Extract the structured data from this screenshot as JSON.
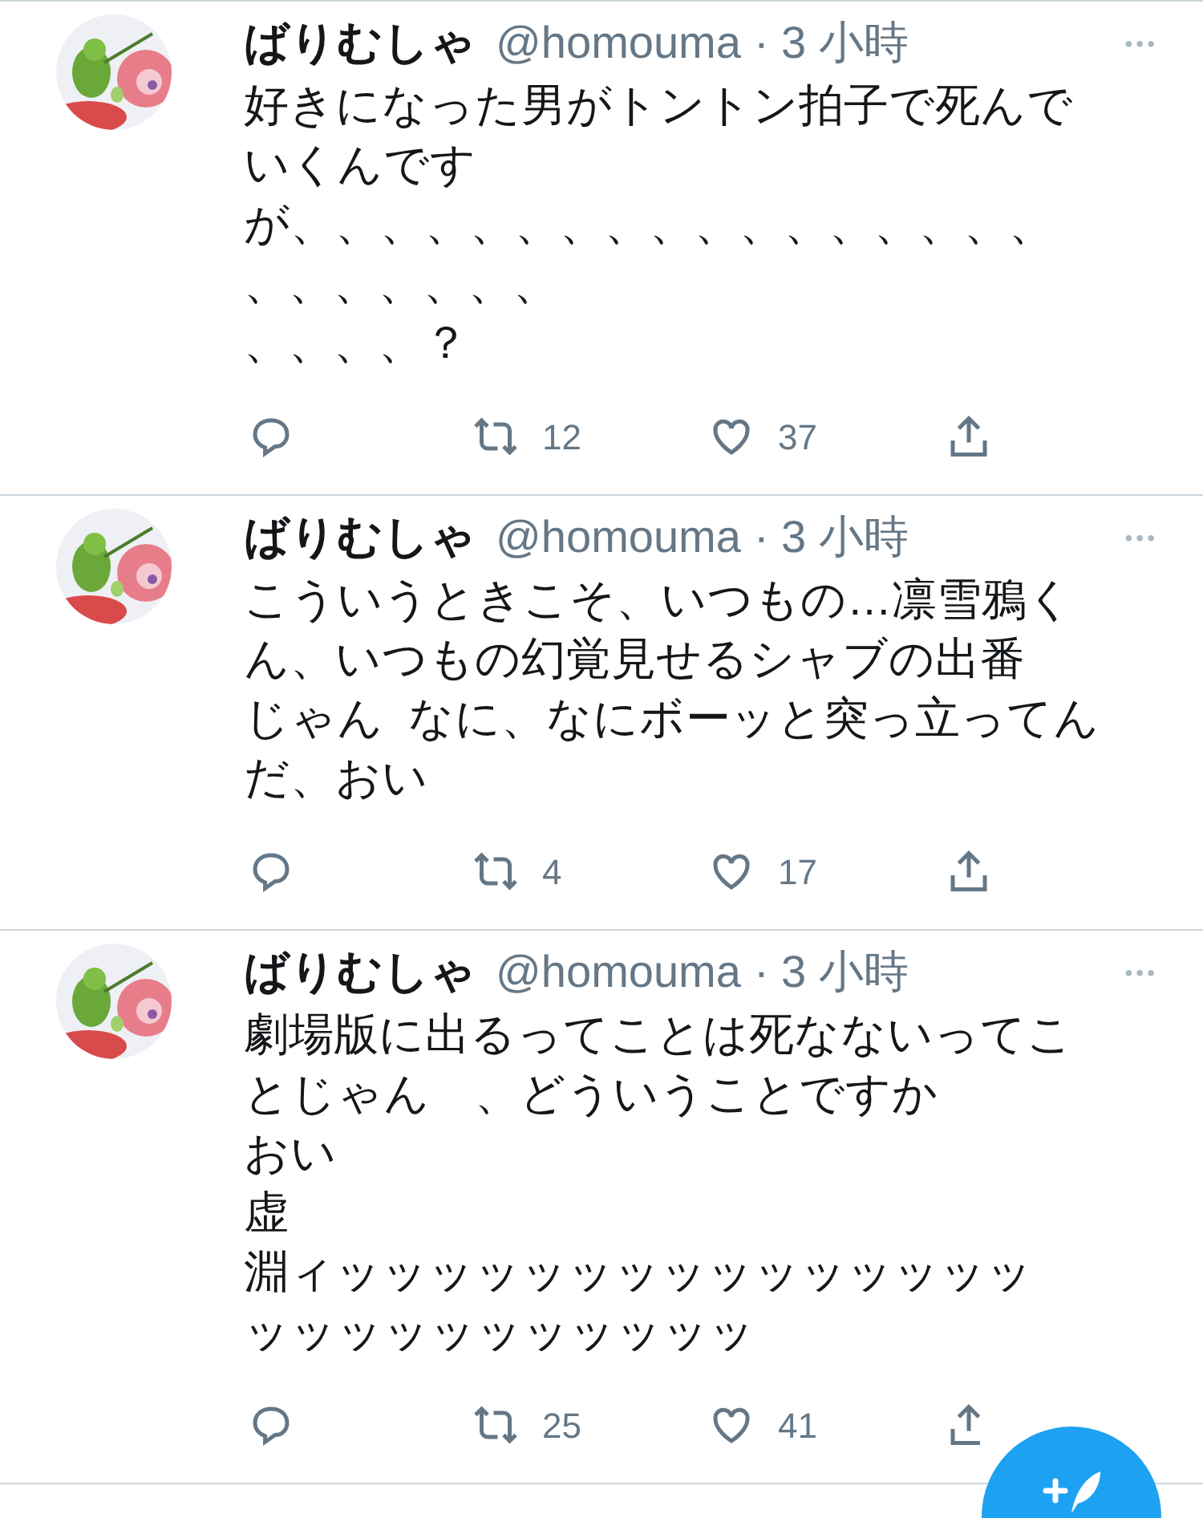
{
  "tweets": [
    {
      "name": "ばりむしゃ",
      "handle": "@homouma",
      "time": "· 3 小時",
      "more": "•••",
      "lines": [
        "好きになった男がトントン拍子で死んで",
        "いくんです",
        "が、、、、、、、、、、、、、、、、、",
        "、、、、、、、",
        "、、、、？"
      ],
      "retweets": "12",
      "likes": "37"
    },
    {
      "name": "ばりむしゃ",
      "handle": "@homouma",
      "time": "· 3 小時",
      "more": "•••",
      "lines": [
        "こういうときこそ、いつもの…凛雪鴉く",
        "ん、いつもの幻覚見せるシャブの出番",
        "じゃん  なに、なにボーッと突っ立ってん",
        "だ、おい"
      ],
      "retweets": "4",
      "likes": "17"
    },
    {
      "name": "ばりむしゃ",
      "handle": "@homouma",
      "time": "· 3 小時",
      "more": "•••",
      "lines": [
        "劇場版に出るってことは死なないってこ",
        "とじゃん　、どういうことですか",
        "おい",
        "虚",
        "淵ィッッッッッッッッッッッッッッッ",
        "ッッッッッッッッッッッ"
      ],
      "retweets": "25",
      "likes": "41"
    }
  ]
}
